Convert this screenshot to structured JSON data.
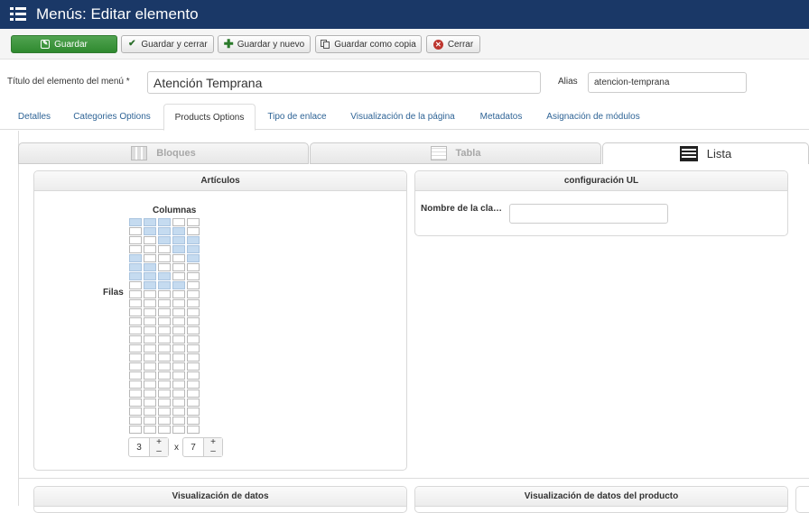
{
  "header": {
    "title": "Menús: Editar elemento",
    "menu_icon": "list-icon"
  },
  "toolbar": {
    "save": "Guardar",
    "save_close": "Guardar y cerrar",
    "save_new": "Guardar y nuevo",
    "save_copy": "Guardar como copia",
    "close": "Cerrar"
  },
  "form": {
    "title_label": "Título del elemento del menú *",
    "title_value": "Atención Temprana",
    "alias_label": "Alias",
    "alias_value": "atencion-temprana"
  },
  "tabs": [
    "Detalles",
    "Categories Options",
    "Products Options",
    "Tipo de enlace",
    "Visualización de la página",
    "Metadatos",
    "Asignación de módulos"
  ],
  "active_tab": "Products Options",
  "view_tabs": [
    {
      "label": "Bloques",
      "icon": "grid-icon"
    },
    {
      "label": "Tabla",
      "icon": "table-icon"
    },
    {
      "label": "Lista",
      "icon": "list-view-icon"
    }
  ],
  "active_view": "Lista",
  "articles_panel": {
    "title": "Artículos",
    "columns_label": "Columnas",
    "rows_label": "Filas",
    "columns_value": "3",
    "times": "x",
    "rows_value": "7",
    "plus": "+",
    "minus": "–"
  },
  "ul_panel": {
    "title": "configuración UL",
    "class_label": "Nombre de la cla…",
    "class_value": ""
  },
  "bottom_panels": [
    "Visualización de datos",
    "Visualización de datos del producto"
  ],
  "colors": {
    "header": "#1a3867",
    "primary": "#46a546",
    "link": "#2f6496",
    "selected_cell": "#c5dbf0"
  }
}
